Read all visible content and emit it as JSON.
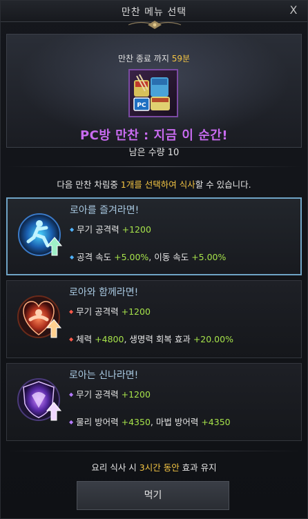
{
  "window": {
    "title": "만찬 메뉴 선택",
    "close_glyph": "X"
  },
  "banner": {
    "timer_prefix": "만찬 종료 까지 ",
    "timer_value": "59분",
    "headline": "PC방 만찬 : 지금 이 순간!",
    "remaining": "남은 수량 10",
    "icon": "pc-cafe-noodle-icon",
    "icon_label": "PC"
  },
  "instruction": {
    "prefix": "다음 만찬 차림중 ",
    "highlight": "1개를 선택하여 식사",
    "suffix": "할 수 있습니다."
  },
  "options": [
    {
      "title": "로아를 즐겨라면!",
      "icon": "running-figure-icon",
      "line1_label": "무기 공격력 ",
      "line1_value": "+1200",
      "line2_label_a": "공격 속도 ",
      "line2_value_a": "+5.00%",
      "line2_label_b": ", 이동 속도 ",
      "line2_value_b": "+5.00%",
      "bullet_color": "#4fb3ff",
      "selected": true
    },
    {
      "title": "로아와 함께라면!",
      "icon": "heart-muscle-icon",
      "line1_label": "무기 공격력 ",
      "line1_value": "+1200",
      "line2_label_a": "체력 ",
      "line2_value_a": "+4800",
      "line2_label_b": ", 생명력 회복 효과 ",
      "line2_value_b": "+20.00%",
      "bullet_color": "#ff5a4a",
      "selected": false
    },
    {
      "title": "로아는 신나라면!",
      "icon": "shield-crest-icon",
      "line1_label": "무기 공격력 ",
      "line1_value": "+1200",
      "line2_label_a": "물리 방어력 ",
      "line2_value_a": "+4350",
      "line2_label_b": ", 마법 방어력 ",
      "line2_value_b": "+4350",
      "bullet_color": "#b57bff",
      "selected": false
    }
  ],
  "footer": {
    "prefix": "요리 식사 시 ",
    "highlight": "3시간 동안",
    "suffix": " 효과 유지"
  },
  "eat_button": "먹기",
  "colors": {
    "accent_gold": "#f3c443",
    "stat_green": "#a6e24a",
    "headline_purple": "#c86bf0",
    "selected_border": "#6fa4c6"
  }
}
